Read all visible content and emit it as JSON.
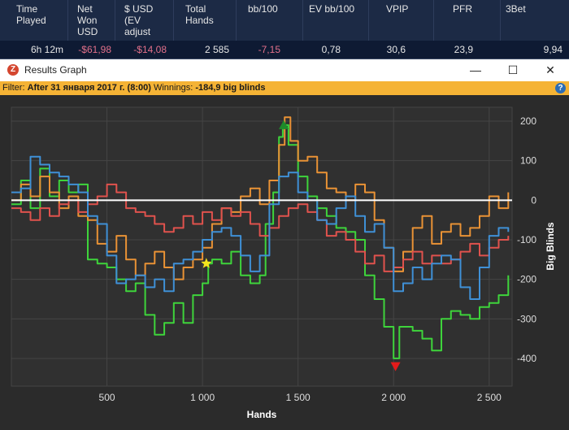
{
  "stats": {
    "headers": [
      {
        "text": "Time\nPlayed"
      },
      {
        "text": "Net\nWon\nUSD"
      },
      {
        "text": "$ USD\n(EV\nadjust"
      },
      {
        "text": "Total\nHands"
      },
      {
        "text": "bb/100"
      },
      {
        "text": "EV bb/100"
      },
      {
        "text": "VPIP"
      },
      {
        "text": "PFR"
      },
      {
        "text": "3Bet"
      }
    ],
    "values": [
      "6h 12m",
      "-$61,98",
      "-$14,08",
      "2 585",
      "-7,15",
      "0,78",
      "30,6",
      "23,9",
      "9,94"
    ]
  },
  "window": {
    "icon_glyph": "Z",
    "title": "Results Graph",
    "minimize_glyph": "—",
    "maximize_glyph": "☐",
    "close_glyph": "✕"
  },
  "filter": {
    "prefix": "Filter:",
    "value": "After 31 января 2017 г. (8:00)",
    "winnings_label": "Winnings:",
    "winnings_value": "-184,9 big blinds",
    "help_glyph": "?"
  },
  "chart_data": {
    "type": "line",
    "xlabel": "Hands",
    "ylabel": "Big Blinds",
    "xlim": [
      0,
      2620
    ],
    "ylim": [
      -470,
      235
    ],
    "x_ticks": [
      {
        "v": 500,
        "label": "500"
      },
      {
        "v": 1000,
        "label": "1 000"
      },
      {
        "v": 1500,
        "label": "1 500"
      },
      {
        "v": 2000,
        "label": "2 000"
      },
      {
        "v": 2500,
        "label": "2 500"
      }
    ],
    "y_ticks": [
      {
        "v": 200,
        "label": "200"
      },
      {
        "v": 100,
        "label": "100"
      },
      {
        "v": 0,
        "label": "0"
      },
      {
        "v": -100,
        "label": "-100"
      },
      {
        "v": -200,
        "label": "-200"
      },
      {
        "v": -300,
        "label": "-300"
      },
      {
        "v": -400,
        "label": "-400"
      }
    ],
    "grid": true,
    "baseline": 0,
    "series": [
      {
        "color": "#3ed43b",
        "points": [
          [
            0,
            -10
          ],
          [
            50,
            50
          ],
          [
            100,
            -20
          ],
          [
            150,
            80
          ],
          [
            200,
            10
          ],
          [
            250,
            50
          ],
          [
            300,
            20
          ],
          [
            350,
            40
          ],
          [
            400,
            -150
          ],
          [
            450,
            -160
          ],
          [
            500,
            -170
          ],
          [
            550,
            -200
          ],
          [
            600,
            -230
          ],
          [
            650,
            -210
          ],
          [
            700,
            -290
          ],
          [
            750,
            -340
          ],
          [
            800,
            -310
          ],
          [
            850,
            -260
          ],
          [
            900,
            -310
          ],
          [
            950,
            -240
          ],
          [
            1000,
            -210
          ],
          [
            1030,
            -160
          ],
          [
            1050,
            -150
          ],
          [
            1100,
            -160
          ],
          [
            1150,
            -130
          ],
          [
            1200,
            -190
          ],
          [
            1250,
            -210
          ],
          [
            1300,
            -190
          ],
          [
            1330,
            -60
          ],
          [
            1370,
            20
          ],
          [
            1400,
            160
          ],
          [
            1420,
            190
          ],
          [
            1450,
            140
          ],
          [
            1500,
            60
          ],
          [
            1550,
            10
          ],
          [
            1600,
            -20
          ],
          [
            1650,
            -40
          ],
          [
            1700,
            -70
          ],
          [
            1750,
            -80
          ],
          [
            1800,
            -100
          ],
          [
            1850,
            -190
          ],
          [
            1900,
            -250
          ],
          [
            1950,
            -320
          ],
          [
            2000,
            -400
          ],
          [
            2030,
            -320
          ],
          [
            2100,
            -330
          ],
          [
            2150,
            -350
          ],
          [
            2200,
            -380
          ],
          [
            2250,
            -300
          ],
          [
            2300,
            -280
          ],
          [
            2350,
            -290
          ],
          [
            2400,
            -300
          ],
          [
            2450,
            -270
          ],
          [
            2500,
            -260
          ],
          [
            2550,
            -240
          ],
          [
            2600,
            -190
          ]
        ]
      },
      {
        "color": "#e99235",
        "points": [
          [
            0,
            0
          ],
          [
            50,
            40
          ],
          [
            100,
            10
          ],
          [
            150,
            60
          ],
          [
            200,
            20
          ],
          [
            250,
            -20
          ],
          [
            300,
            10
          ],
          [
            350,
            -40
          ],
          [
            400,
            -50
          ],
          [
            450,
            -110
          ],
          [
            500,
            -130
          ],
          [
            550,
            -90
          ],
          [
            600,
            -150
          ],
          [
            650,
            -190
          ],
          [
            700,
            -160
          ],
          [
            750,
            -130
          ],
          [
            800,
            -170
          ],
          [
            850,
            -200
          ],
          [
            900,
            -170
          ],
          [
            950,
            -150
          ],
          [
            1000,
            -120
          ],
          [
            1050,
            -60
          ],
          [
            1100,
            -20
          ],
          [
            1150,
            -30
          ],
          [
            1200,
            10
          ],
          [
            1250,
            30
          ],
          [
            1300,
            -10
          ],
          [
            1350,
            50
          ],
          [
            1400,
            140
          ],
          [
            1430,
            210
          ],
          [
            1460,
            150
          ],
          [
            1500,
            100
          ],
          [
            1550,
            110
          ],
          [
            1600,
            70
          ],
          [
            1650,
            30
          ],
          [
            1700,
            20
          ],
          [
            1750,
            0
          ],
          [
            1800,
            40
          ],
          [
            1850,
            20
          ],
          [
            1900,
            -50
          ],
          [
            1950,
            -120
          ],
          [
            2000,
            -180
          ],
          [
            2050,
            -130
          ],
          [
            2100,
            -70
          ],
          [
            2150,
            -40
          ],
          [
            2200,
            -110
          ],
          [
            2250,
            -80
          ],
          [
            2300,
            -60
          ],
          [
            2350,
            -90
          ],
          [
            2400,
            -70
          ],
          [
            2450,
            -40
          ],
          [
            2500,
            10
          ],
          [
            2550,
            -20
          ],
          [
            2600,
            20
          ]
        ]
      },
      {
        "color": "#e0524d",
        "points": [
          [
            0,
            -20
          ],
          [
            50,
            -30
          ],
          [
            100,
            -50
          ],
          [
            150,
            -20
          ],
          [
            200,
            -40
          ],
          [
            250,
            -10
          ],
          [
            300,
            0
          ],
          [
            350,
            -30
          ],
          [
            400,
            -10
          ],
          [
            450,
            10
          ],
          [
            500,
            40
          ],
          [
            550,
            20
          ],
          [
            600,
            -20
          ],
          [
            650,
            -30
          ],
          [
            700,
            -40
          ],
          [
            750,
            -60
          ],
          [
            800,
            -80
          ],
          [
            850,
            -70
          ],
          [
            900,
            -40
          ],
          [
            950,
            -60
          ],
          [
            1000,
            -30
          ],
          [
            1050,
            -50
          ],
          [
            1100,
            -20
          ],
          [
            1150,
            -40
          ],
          [
            1200,
            -30
          ],
          [
            1250,
            -60
          ],
          [
            1300,
            -90
          ],
          [
            1350,
            -70
          ],
          [
            1400,
            -40
          ],
          [
            1450,
            -20
          ],
          [
            1500,
            -10
          ],
          [
            1550,
            -30
          ],
          [
            1600,
            -50
          ],
          [
            1650,
            -90
          ],
          [
            1700,
            -80
          ],
          [
            1750,
            -100
          ],
          [
            1800,
            -130
          ],
          [
            1850,
            -160
          ],
          [
            1900,
            -140
          ],
          [
            1950,
            -180
          ],
          [
            2000,
            -170
          ],
          [
            2050,
            -150
          ],
          [
            2100,
            -130
          ],
          [
            2150,
            -160
          ],
          [
            2200,
            -140
          ],
          [
            2250,
            -160
          ],
          [
            2300,
            -150
          ],
          [
            2350,
            -130
          ],
          [
            2400,
            -110
          ],
          [
            2450,
            -140
          ],
          [
            2500,
            -120
          ],
          [
            2550,
            -100
          ],
          [
            2600,
            -90
          ]
        ]
      },
      {
        "color": "#3f90d6",
        "points": [
          [
            0,
            20
          ],
          [
            50,
            30
          ],
          [
            100,
            110
          ],
          [
            150,
            90
          ],
          [
            200,
            70
          ],
          [
            250,
            60
          ],
          [
            300,
            40
          ],
          [
            350,
            20
          ],
          [
            400,
            -40
          ],
          [
            450,
            -60
          ],
          [
            500,
            -140
          ],
          [
            550,
            -210
          ],
          [
            600,
            -200
          ],
          [
            650,
            -190
          ],
          [
            700,
            -220
          ],
          [
            750,
            -200
          ],
          [
            800,
            -230
          ],
          [
            850,
            -160
          ],
          [
            900,
            -150
          ],
          [
            950,
            -130
          ],
          [
            1000,
            -100
          ],
          [
            1050,
            -80
          ],
          [
            1100,
            -70
          ],
          [
            1150,
            -90
          ],
          [
            1200,
            -140
          ],
          [
            1250,
            -180
          ],
          [
            1300,
            -140
          ],
          [
            1350,
            -10
          ],
          [
            1400,
            60
          ],
          [
            1450,
            70
          ],
          [
            1500,
            20
          ],
          [
            1550,
            0
          ],
          [
            1600,
            -50
          ],
          [
            1650,
            -60
          ],
          [
            1700,
            -20
          ],
          [
            1750,
            10
          ],
          [
            1800,
            -40
          ],
          [
            1850,
            -80
          ],
          [
            1900,
            -60
          ],
          [
            1950,
            -120
          ],
          [
            2000,
            -230
          ],
          [
            2050,
            -210
          ],
          [
            2100,
            -170
          ],
          [
            2150,
            -200
          ],
          [
            2200,
            -160
          ],
          [
            2250,
            -140
          ],
          [
            2300,
            -150
          ],
          [
            2350,
            -220
          ],
          [
            2400,
            -250
          ],
          [
            2450,
            -170
          ],
          [
            2500,
            -90
          ],
          [
            2550,
            -70
          ],
          [
            2600,
            -80
          ]
        ]
      }
    ],
    "markers": [
      {
        "type": "star",
        "x": 1020,
        "y": -160,
        "color": "#f3e51e"
      },
      {
        "type": "triangle-up",
        "x": 1425,
        "y": 190,
        "color": "#1e8a2a"
      },
      {
        "type": "triangle-down",
        "x": 2010,
        "y": -420,
        "color": "#e41b1b"
      }
    ]
  }
}
